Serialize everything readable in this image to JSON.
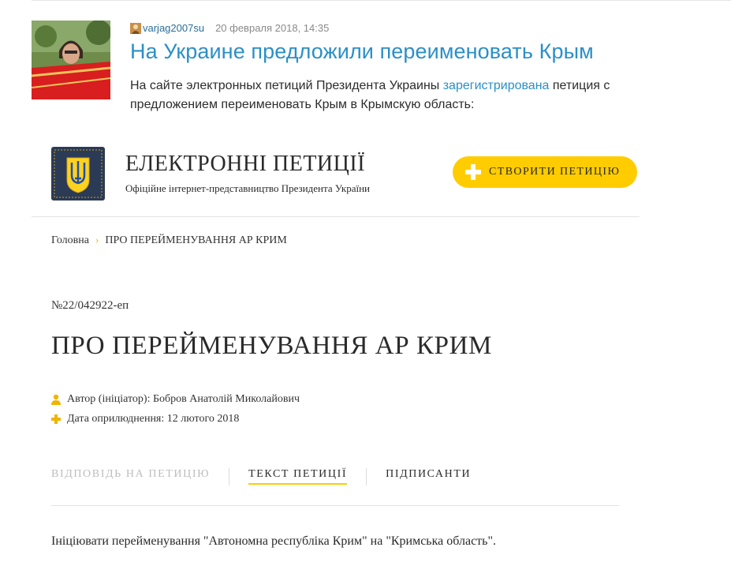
{
  "post": {
    "author": "varjag2007su",
    "date": "20 февраля 2018, 14:35",
    "title": "На Украине предложили переименовать Крым",
    "lead_before": "На сайте электронных петиций Президента Украины ",
    "lead_link": "зарегистрирована",
    "lead_after": " петиция с предложением переименовать Крым в Крымскую область:"
  },
  "site": {
    "title": "ЕЛЕКТРОННІ ПЕТИЦІЇ",
    "subtitle": "Офіційне інтернет-представництво Президента України",
    "create_button": "СТВОРИТИ ПЕТИЦІЮ"
  },
  "breadcrumb": {
    "home": "Головна",
    "separator": "›",
    "current": "ПРО ПЕРЕЙМЕНУВАННЯ АР КРИМ"
  },
  "petition": {
    "number": "№22/042922-еп",
    "title": "ПРО ПЕРЕЙМЕНУВАННЯ АР КРИМ",
    "author_line": "Автор (ініціатор): Бобров Анатолій Миколайович",
    "date_line": "Дата оприлюднення: 12 лютого 2018",
    "body": "Ініціювати перейменування \"Автономна республіка Крим\" на \"Кримська область\"."
  },
  "tabs": [
    {
      "label": "ВІДПОВІДЬ НА ПЕТИЦІЮ",
      "state": "disabled"
    },
    {
      "label": "ТЕКСТ ПЕТИЦІЇ",
      "state": "active"
    },
    {
      "label": "ПІДПИСАНТИ",
      "state": "normal"
    }
  ],
  "colors": {
    "link": "#2b8fc7",
    "accent": "#ffcc00",
    "emblem_bg": "#2b3a55"
  }
}
